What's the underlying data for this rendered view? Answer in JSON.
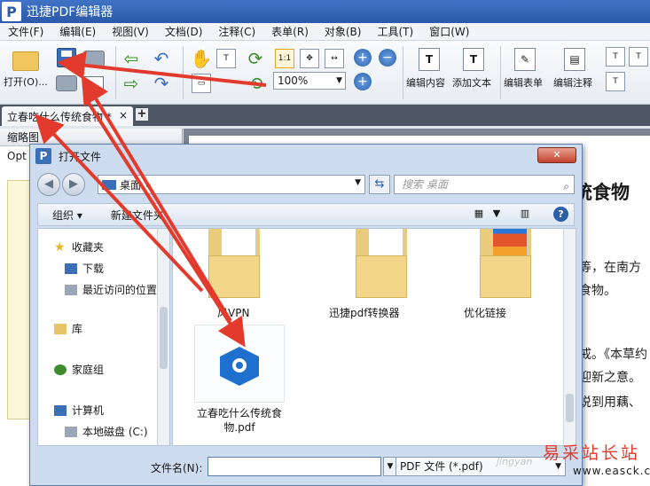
{
  "app": {
    "logo": "P",
    "title": "迅捷PDF编辑器"
  },
  "menu": [
    "文件(F)",
    "编辑(E)",
    "视图(V)",
    "文档(D)",
    "注释(C)",
    "表单(R)",
    "对象(B)",
    "工具(T)",
    "窗口(W)"
  ],
  "toolbar": {
    "open_label": "打开(O)...",
    "zoom_value": "100%",
    "edit_content": "编辑内容",
    "add_text": "添加文本",
    "edit_form": "编辑表单",
    "edit_annotation": "编辑注释",
    "actual_size_icon": "1:1"
  },
  "tab": {
    "title": "立春吃什么传统食物 *",
    "close": "×",
    "new": "+"
  },
  "sidebar": {
    "header": "缩略图",
    "row": "Opt"
  },
  "document": {
    "title_fragment": "统食物",
    "lines": [
      "等，在南方",
      "食物。",
      "戒。《本草约",
      "迎新之意。",
      "说到用藕、"
    ]
  },
  "dialog": {
    "logo": "P",
    "title": "打开文件",
    "path": "桌面",
    "path_arrow": "▸",
    "search_placeholder": "搜索 桌面",
    "organize": "组织 ▾",
    "new_folder": "新建文件夹",
    "nav_items": [
      "收藏夹",
      "下载",
      "最近访问的位置",
      "库",
      "家庭组",
      "计算机",
      "本地磁盘 (C:)"
    ],
    "folders": [
      "风VPN",
      "迅捷pdf转换器",
      "优化链接"
    ],
    "file_name_line1": "立春吃什么传统食",
    "file_name_line2": "物.pdf",
    "filename_label": "文件名(N):",
    "filename_value": "",
    "filetype_value": "PDF 文件 (*.pdf)"
  },
  "watermark": {
    "site_cn": "易采站长站",
    "site_url": "www.easck.com",
    "faint": "jingyan"
  },
  "colors": {
    "titlebar": "#2a5aa8",
    "annotation_arrow": "#e23b2e",
    "dialog": "#cddcee"
  },
  "icons": [
    "folder-icon",
    "save-icon",
    "print-icon",
    "email-icon",
    "undo-icon",
    "redo-icon",
    "hand-icon",
    "select-icon",
    "rotate-icon",
    "zoom-in-icon",
    "zoom-out-icon",
    "edit-content-icon",
    "add-text-icon",
    "edit-form-icon",
    "edit-annotation-icon"
  ]
}
